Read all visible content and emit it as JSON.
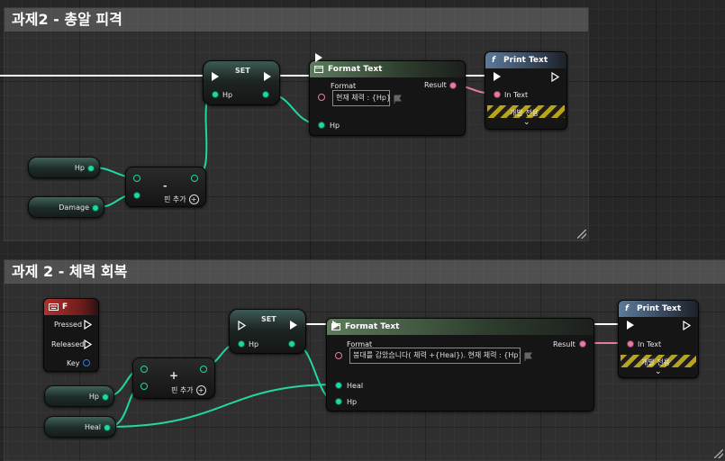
{
  "comments": [
    {
      "title": "과제2 - 총알 피격"
    },
    {
      "title": "과제 2 - 체력 회복"
    }
  ],
  "graph1": {
    "hp_var": "Hp",
    "damage_var": "Damage",
    "subtract_op": "-",
    "add_pin_label": "핀 추가",
    "set_title": "SET",
    "set_pin": "Hp",
    "format_title": "Format Text",
    "format_label": "Format",
    "format_value": "현재 체력 : {Hp}",
    "format_result": "Result",
    "format_pin_hp": "Hp",
    "print_title": "Print Text",
    "print_in_text": "In Text",
    "dev_only": "개발 전용"
  },
  "graph2": {
    "key_title": "F",
    "key_pressed": "Pressed",
    "key_released": "Released",
    "key_key": "Key",
    "hp_var": "Hp",
    "heal_var": "Heal",
    "add_op": "+",
    "add_pin_label": "핀 추가",
    "set_title": "SET",
    "set_pin": "Hp",
    "format_title": "Format Text",
    "format_label": "Format",
    "format_value": "붕대를 감았습니다( 체력 +{Heal}). 현재 체력 : {Hp}",
    "format_result": "Result",
    "format_pin_heal": "Heal",
    "format_pin_hp": "Hp",
    "print_title": "Print Text",
    "print_in_text": "In Text",
    "dev_only": "개발 전용"
  },
  "colors": {
    "float_pin": "#20d7a4",
    "text_pin": "#e77ba7",
    "exec_wire": "#ffffff",
    "struct_pin": "#2d7be0"
  },
  "icons": {
    "function": "function-icon",
    "format": "format-text-icon",
    "keyboard": "keyboard-icon"
  }
}
